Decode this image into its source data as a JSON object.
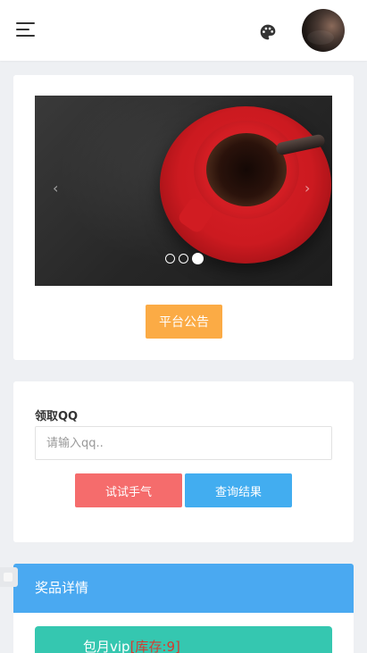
{
  "header": {
    "menu_icon": "hamburger-menu-icon",
    "theme_icon": "palette-icon",
    "avatar": "user-avatar"
  },
  "banner": {
    "carousel": {
      "slide_count": 3,
      "active_index": 2,
      "prev_label": "‹",
      "next_label": "›"
    },
    "notice_button": "平台公告"
  },
  "form": {
    "label": "领取QQ",
    "qq_placeholder": "请输入qq..",
    "try_button": "试试手气",
    "query_button": "查询结果"
  },
  "prizes": {
    "title": "奖品详情",
    "items": [
      {
        "name": "包月vip",
        "stock": "[库存:9]"
      }
    ]
  },
  "colors": {
    "accent_orange": "#fbab45",
    "accent_red": "#f56c6c",
    "accent_blue": "#42adf0",
    "prize_header": "#4aa9f1",
    "prize_item": "#35c7b0",
    "stock_text": "#d63b2f",
    "page_bg": "#eef0f3"
  }
}
